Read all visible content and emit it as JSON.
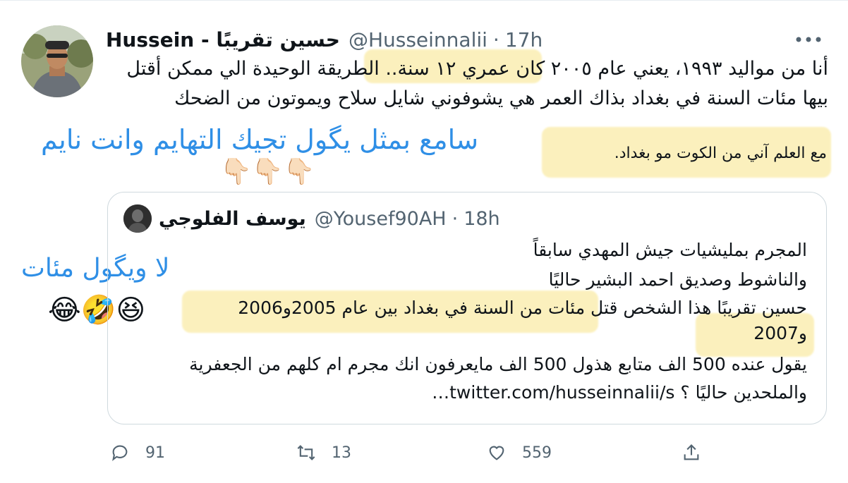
{
  "tweet": {
    "display_name": "Hussein - حسين تقريبًا",
    "handle": "@Husseinnalii",
    "time": "17h",
    "line1": "أنا من مواليد ١٩٩٣، يعني عام ٢٠٠٥ كان عمري ١٢ سنة.. الطريقة الوحيدة الي ممكن أقتل",
    "line2": "بيها مئات السنة في بغداد بذاك العمر هي يشوفوني شايل سلاح ويموتون من الضحك",
    "note": "مع العلم آني من الكوت مو بغداد."
  },
  "annotations": {
    "top_comment": "سامع بمثل يگول تجيك التهايم وانت نايم",
    "point_emojis": "👇🏻👇🏻👇🏻",
    "side_comment": "لا ويگول مئات",
    "laugh_emojis": "😂🤣😆"
  },
  "quote": {
    "display_name": "يوسف الفلوجي",
    "handle": "@Yousef90AH",
    "time": "18h",
    "line1": "المجرم بمليشيات جيش المهدي سابقاً",
    "line2": "والناشوط وصديق احمد البشير حاليًا",
    "line3": "حسين تقريبًا هذا الشخص قتل مئات من السنة في بغداد بين عام 2005و2006",
    "line4": "و2007",
    "line5": "يقول عنده 500 الف متابع هذول 500 الف مايعرفون انك مجرم ام كلهم من الجعفرية",
    "line6": "والملحدين حاليًا ؟ twitter.com/husseinnalii/s…"
  },
  "actions": {
    "replies": "91",
    "retweets": "13",
    "likes": "559"
  },
  "colors": {
    "highlight": "#fbeeb2",
    "annotation_blue": "#2f8fe6",
    "muted": "#536471"
  }
}
